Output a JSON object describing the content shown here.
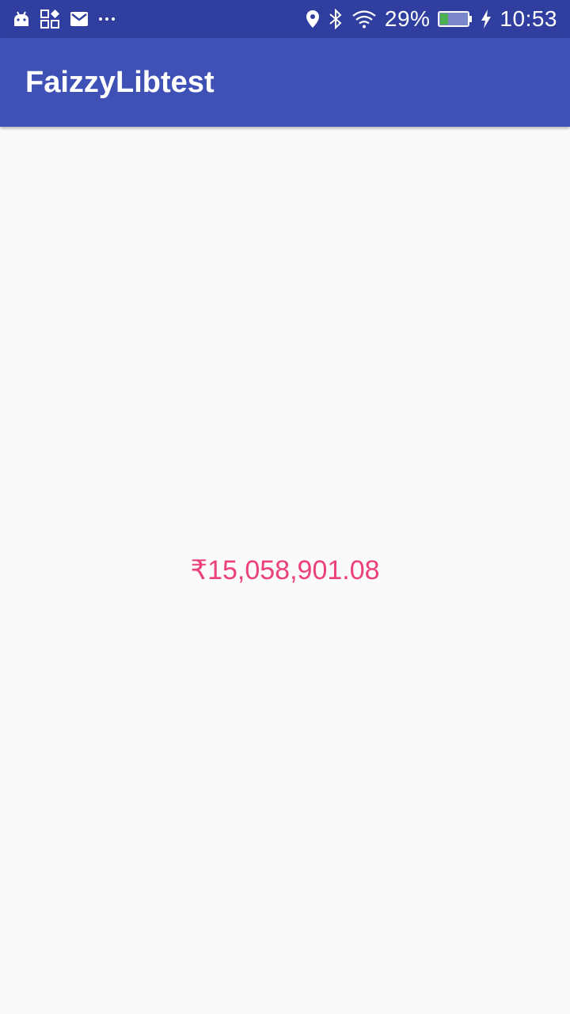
{
  "status_bar": {
    "left_icons": [
      "android-icon",
      "apps-icon",
      "mail-icon",
      "more-icon"
    ],
    "right_icons": [
      "location-icon",
      "bluetooth-icon",
      "wifi-icon",
      "battery-icon",
      "charging-icon"
    ],
    "battery_percent": "29%",
    "battery_level": 0.29,
    "time": "10:53"
  },
  "app_bar": {
    "title": "FaizzyLibtest"
  },
  "main": {
    "amount": "₹15,058,901.08"
  },
  "colors": {
    "status_bar": "#303f9f",
    "app_bar": "#3f51b5",
    "background": "#fafafa",
    "amount_text": "#ec407a",
    "battery_fill": "#4caf50"
  }
}
